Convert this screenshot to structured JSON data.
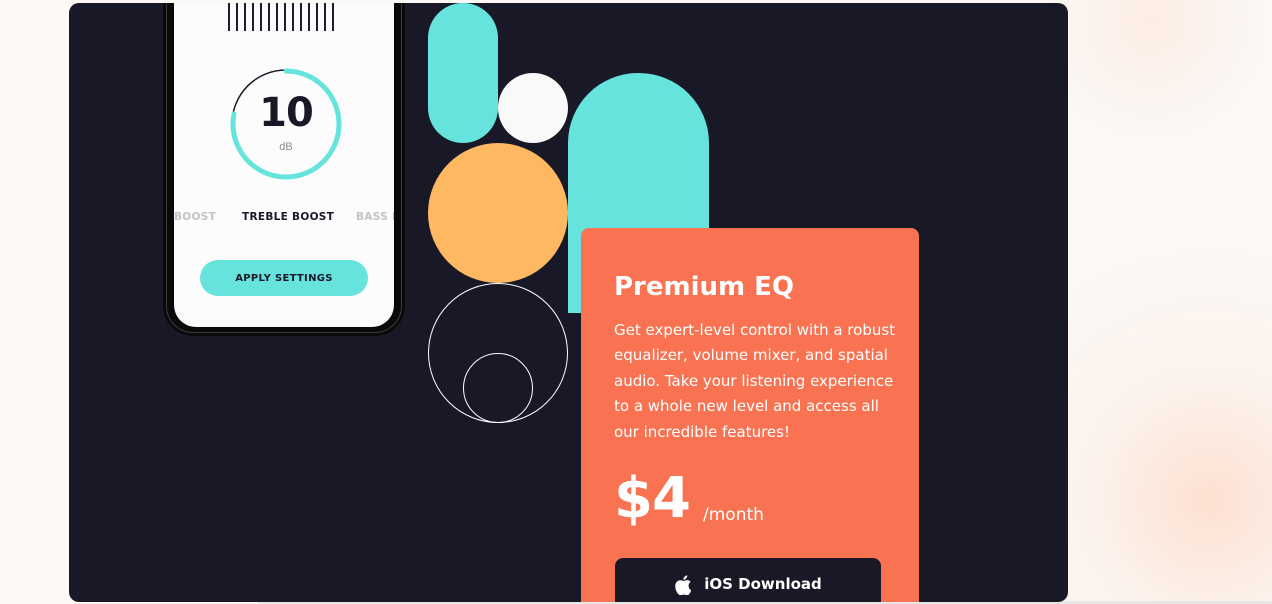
{
  "phone": {
    "dial_value": "10",
    "dial_unit": "dB",
    "dial_progress": 0.78,
    "presets": {
      "left": "BOOST",
      "active": "TREBLE BOOST",
      "right": "BASS B"
    },
    "apply_label": "APPLY SETTINGS"
  },
  "card": {
    "title": "Premium EQ",
    "description": "Get expert-level control with a robust equalizer, volume mixer, and spatial audio. Take your listening experience to a whole new level and access all our incredible features!",
    "price": "$4",
    "period": "/month",
    "download_label": "iOS Download",
    "download_icon": "apple-icon"
  },
  "colors": {
    "dark": "#191827",
    "teal": "#66e3dd",
    "orange": "#ffb862",
    "coral": "#f97352",
    "white": "#faf9f9"
  }
}
